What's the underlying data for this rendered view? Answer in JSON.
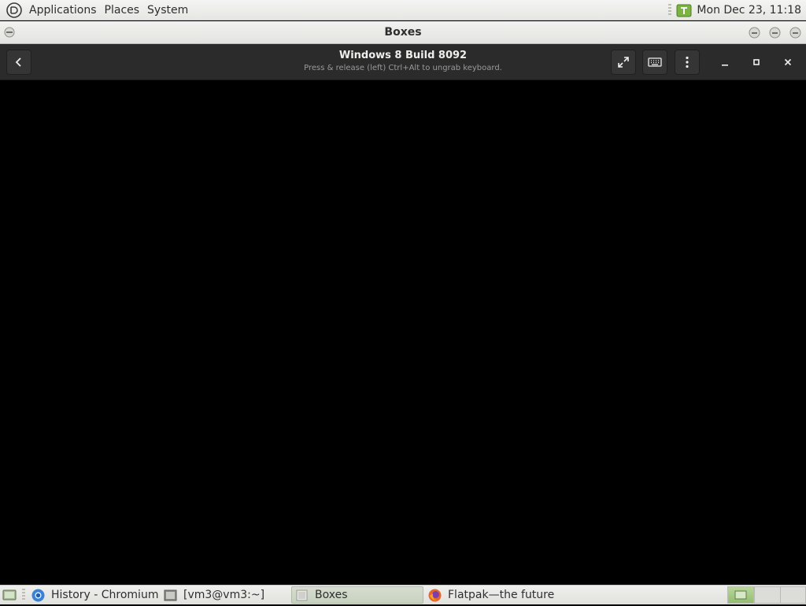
{
  "top_panel": {
    "menus": [
      "Applications",
      "Places",
      "System"
    ],
    "clock": "Mon Dec 23, 11:18"
  },
  "window": {
    "title": "Boxes"
  },
  "headerbar": {
    "title": "Windows 8 Build 8092",
    "subtitle": "Press & release (left) Ctrl+Alt to ungrab keyboard.",
    "icons": [
      "back-arrow",
      "fullscreen",
      "keyboard",
      "kebab-menu",
      "minimize",
      "maximize",
      "close"
    ]
  },
  "taskbar": {
    "tasks": [
      {
        "label": "History - Chromium",
        "icon": "chromium"
      },
      {
        "label": "[vm3@vm3:~]",
        "icon": "terminal"
      },
      {
        "label": "Boxes",
        "icon": "boxes"
      },
      {
        "label": "Flatpak—the future ...",
        "icon": "firefox"
      }
    ],
    "active_task": "Boxes"
  },
  "colors": {
    "headerbar_bg": "#2b2b2b",
    "vm_bg": "#000000",
    "panel_bg": "#ececea",
    "workspace_active": "#a7cb87"
  }
}
